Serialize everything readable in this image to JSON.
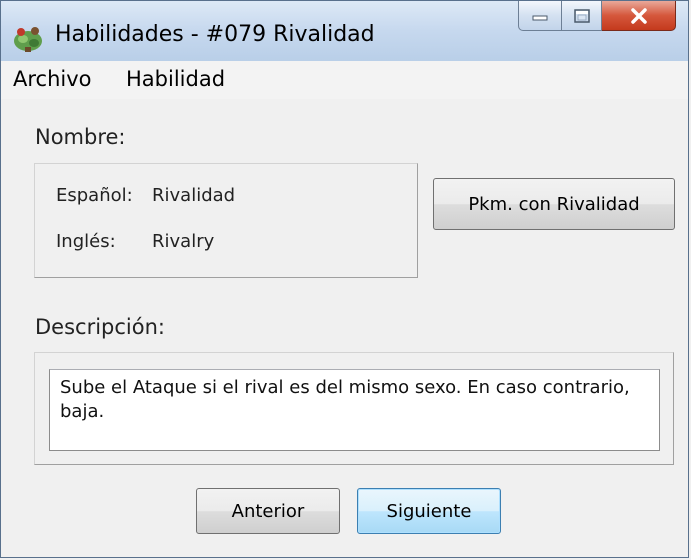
{
  "window": {
    "title": "Habilidades - #079 Rivalidad"
  },
  "menu": {
    "items": [
      "Archivo",
      "Habilidad"
    ]
  },
  "name_section": {
    "heading": "Nombre:",
    "spanish_label": "Español:",
    "spanish_value": "Rivalidad",
    "english_label": "Inglés:",
    "english_value": "Rivalry"
  },
  "pokemon_button_label": "Pkm. con Rivalidad",
  "description_section": {
    "heading": "Descripción:",
    "text": "Sube el Ataque si el rival es del mismo sexo. En caso contrario, baja."
  },
  "navigation": {
    "previous_label": "Anterior",
    "next_label": "Siguiente"
  },
  "icons": {
    "app": "pokemon-app-icon",
    "minimize": "minimize-icon",
    "maximize": "maximize-icon",
    "close": "close-icon"
  }
}
